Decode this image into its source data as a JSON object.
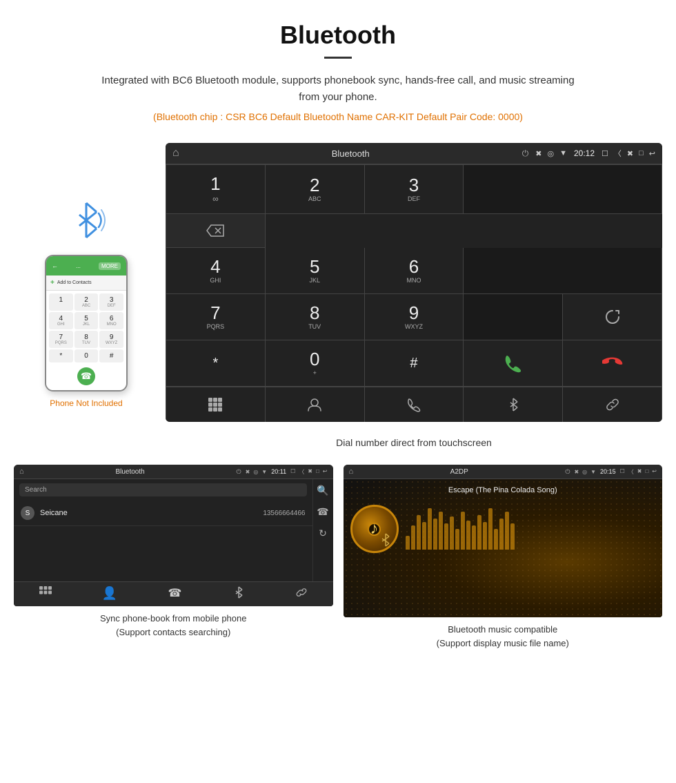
{
  "header": {
    "title": "Bluetooth",
    "description": "Integrated with BC6 Bluetooth module, supports phonebook sync, hands-free call, and music streaming from your phone.",
    "specs": "(Bluetooth chip : CSR BC6    Default Bluetooth Name CAR-KIT    Default Pair Code: 0000)"
  },
  "phone_label": "Phone Not Included",
  "dial_screen": {
    "title": "Bluetooth",
    "time": "20:12",
    "keys": [
      {
        "num": "1",
        "sub": "∞"
      },
      {
        "num": "2",
        "sub": "ABC"
      },
      {
        "num": "3",
        "sub": "DEF"
      },
      {
        "num": "4",
        "sub": "GHI"
      },
      {
        "num": "5",
        "sub": "JKL"
      },
      {
        "num": "6",
        "sub": "MNO"
      },
      {
        "num": "7",
        "sub": "PQRS"
      },
      {
        "num": "8",
        "sub": "TUV"
      },
      {
        "num": "9",
        "sub": "WXYZ"
      },
      {
        "num": "*",
        "sub": ""
      },
      {
        "num": "0",
        "sub": "+"
      },
      {
        "num": "#",
        "sub": ""
      }
    ],
    "caption": "Dial number direct from touchscreen"
  },
  "phonebook_screen": {
    "title": "Bluetooth",
    "time": "20:11",
    "search_placeholder": "Search",
    "contact": {
      "letter": "S",
      "name": "Seicane",
      "number": "13566664466"
    },
    "caption_line1": "Sync phone-book from mobile phone",
    "caption_line2": "(Support contacts searching)"
  },
  "music_screen": {
    "title": "A2DP",
    "time": "20:15",
    "track_name": "Escape (The Pina Colada Song)",
    "visualizer_bars": [
      20,
      35,
      50,
      40,
      60,
      45,
      55,
      38,
      48,
      30,
      55,
      42,
      35,
      50,
      40,
      60,
      30,
      45,
      55,
      38
    ],
    "caption_line1": "Bluetooth music compatible",
    "caption_line2": "(Support display music file name)"
  },
  "phone_keys": [
    {
      "label": "1",
      "sub": ""
    },
    {
      "label": "2",
      "sub": "ABC"
    },
    {
      "label": "3",
      "sub": "DEF"
    },
    {
      "label": "4",
      "sub": "GHI"
    },
    {
      "label": "5",
      "sub": "JKL"
    },
    {
      "label": "6",
      "sub": "MNO"
    },
    {
      "label": "7",
      "sub": "PQRS"
    },
    {
      "label": "8",
      "sub": "TUV"
    },
    {
      "label": "9",
      "sub": "WXYZ"
    },
    {
      "label": "*",
      "sub": ""
    },
    {
      "label": "0",
      "sub": ""
    },
    {
      "label": "#",
      "sub": ""
    }
  ]
}
